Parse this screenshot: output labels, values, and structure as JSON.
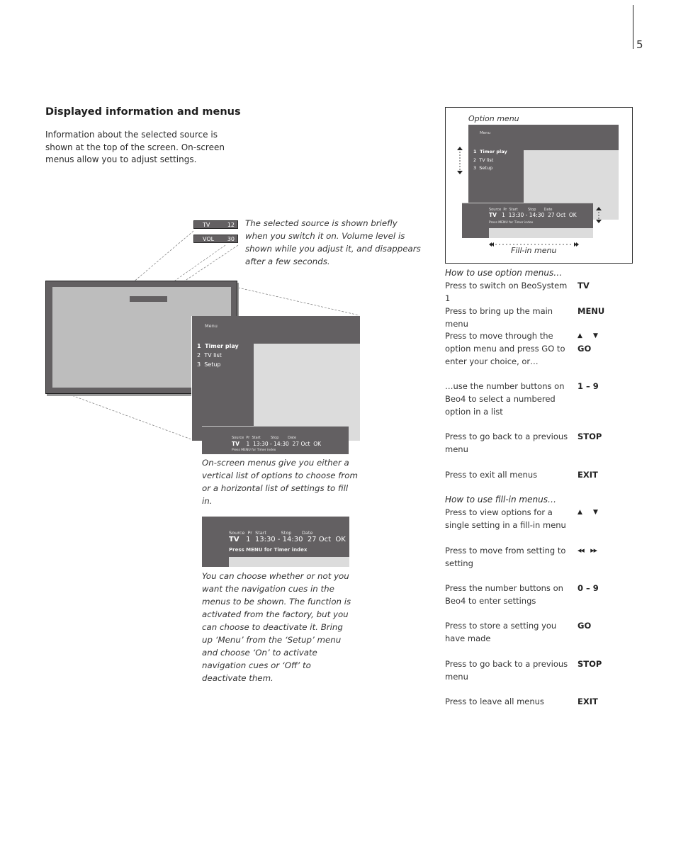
{
  "page": {
    "number": "5"
  },
  "section": {
    "heading": "Displayed information and menus",
    "intro": "Information about the selected source is shown at the top of the screen. On-screen menus allow you to adjust settings."
  },
  "osd": {
    "source_label": "TV",
    "source_value": "12",
    "volume_label": "VOL",
    "volume_value": "30",
    "caption": "The selected source is shown briefly when you switch it on. Volume level is shown while you adjust it, and disappears after a few seconds."
  },
  "option_menu": {
    "title": "Menu",
    "items": [
      {
        "num": "1",
        "label": "Timer play"
      },
      {
        "num": "2",
        "label": "TV list"
      },
      {
        "num": "3",
        "label": "Setup"
      }
    ]
  },
  "fill_in_menu": {
    "headers": [
      "Source",
      "Pr",
      "Start",
      "Stop",
      "Date"
    ],
    "source": "TV",
    "pr": "1",
    "time": "13:30 - 14:30",
    "date": "27 Oct",
    "ok": "OK",
    "hint": "Press MENU for Timer index"
  },
  "captions": {
    "menus": "On-screen menus give you either a vertical list of options to choose from or a horizontal list of settings to fill in.",
    "navigation_cues": "You can choose whether or not you want the navigation cues in the menus to be shown. The function is activated from the factory, but you can choose to deactivate it. Bring up ‘Menu’ from the ‘Setup’ menu and choose ‘On’ to activate navigation cues or ‘Off’ to deactivate them."
  },
  "diagram": {
    "option_menu_label": "Option menu",
    "fill_in_menu_label": "Fill-in menu",
    "icons": [
      "up-down-arrows-icon",
      "rewind-icon",
      "fast-forward-icon"
    ]
  },
  "option_instructions": {
    "title": "How to use option menus…",
    "rows": [
      {
        "desc": "Press to switch on BeoSystem 1",
        "key": "TV"
      },
      {
        "desc": "Press to bring up the main menu",
        "key": "MENU"
      },
      {
        "desc": "Press to move through the option menu and press GO to enter your choice, or…",
        "key": "▲ ▼",
        "key2": "GO"
      },
      {
        "desc": "…use the number buttons on Beo4 to select a numbered option in a list",
        "key": "1 – 9"
      },
      {
        "desc": "Press to go back to a previous menu",
        "key": "STOP"
      },
      {
        "desc": "Press to exit all menus",
        "key": "EXIT"
      }
    ]
  },
  "fillin_instructions": {
    "title": "How to use fill-in menus…",
    "rows": [
      {
        "desc": "Press to view options for a single setting in a fill-in menu",
        "key": "▲ ▼"
      },
      {
        "desc": "Press to move from setting to setting",
        "key": "◀◀ ▶▶"
      },
      {
        "desc": "Press the number buttons on Beo4 to enter settings",
        "key": "0 – 9"
      },
      {
        "desc": "Press to store a setting you have made",
        "key": "GO"
      },
      {
        "desc": "Press to go back to a previous menu",
        "key": "STOP"
      },
      {
        "desc": "Press to leave all menus",
        "key": "EXIT"
      }
    ]
  }
}
